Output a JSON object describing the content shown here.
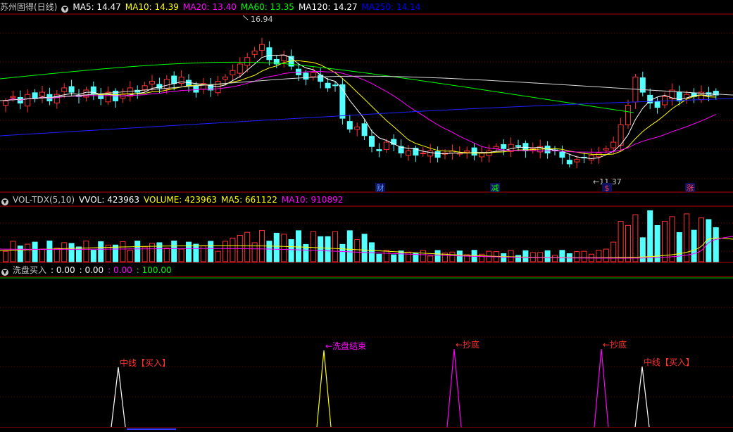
{
  "price_panel": {
    "stock_name": "苏州固得(日线)",
    "ma_labels": [
      {
        "text": "MA5: 14.47",
        "color": "#ffffff"
      },
      {
        "text": "MA10: 14.39",
        "color": "#ffff00"
      },
      {
        "text": "MA20: 13.40",
        "color": "#ff00ff"
      },
      {
        "text": "MA60: 13.35",
        "color": "#00ff00"
      },
      {
        "text": "MA120: 14.27",
        "color": "#ffffff"
      },
      {
        "text": "MA250: 14.14",
        "color": "#0000ff"
      }
    ],
    "high_label": "16.94",
    "low_label": "←11.37",
    "event_markers": [
      {
        "text": "财",
        "color": "#5aa0ff"
      },
      {
        "text": "减",
        "color": "#00ff00"
      },
      {
        "text": "$",
        "color": "#ff4040"
      },
      {
        "text": "涨",
        "color": "#ff4040"
      }
    ]
  },
  "volume_panel": {
    "labels": [
      {
        "text": "VOL-TDX(5,10)",
        "color": "#c8c8c8"
      },
      {
        "text": "VVOL: 423963",
        "color": "#ffffff"
      },
      {
        "text": "VOLUME: 423963",
        "color": "#ffff00"
      },
      {
        "text": "MA5: 661122",
        "color": "#ffff00"
      },
      {
        "text": "MA10: 910892",
        "color": "#ff00ff"
      }
    ]
  },
  "indicator_panel": {
    "labels": [
      {
        "text": "洗盘买入",
        "color": "#c8c8c8"
      },
      {
        "text": ": 0.00",
        "color": "#ffffff"
      },
      {
        "text": ": 0.00",
        "color": "#ffffff"
      },
      {
        "text": ": 0.00",
        "color": "#ff00ff"
      },
      {
        "text": ": 100.00",
        "color": "#00ff00"
      }
    ],
    "signals": [
      {
        "text": "中线【买入】",
        "color": "#ff3030",
        "stroke": "#ffffff"
      },
      {
        "text": "←洗盘结束",
        "color": "#ff00ff",
        "stroke": "#ffff00"
      },
      {
        "text": "←抄底",
        "color": "#ff3030",
        "stroke": "#ff00ff"
      },
      {
        "text": "←抄底",
        "color": "#ff3030",
        "stroke": "#ff00ff"
      },
      {
        "text": "中线【买入】",
        "color": "#ff3030",
        "stroke": "#ffffff"
      }
    ]
  },
  "colors": {
    "up": "#ff3232",
    "down": "#54ffff",
    "grid": "#7a0000",
    "frame": "#b00000"
  }
}
